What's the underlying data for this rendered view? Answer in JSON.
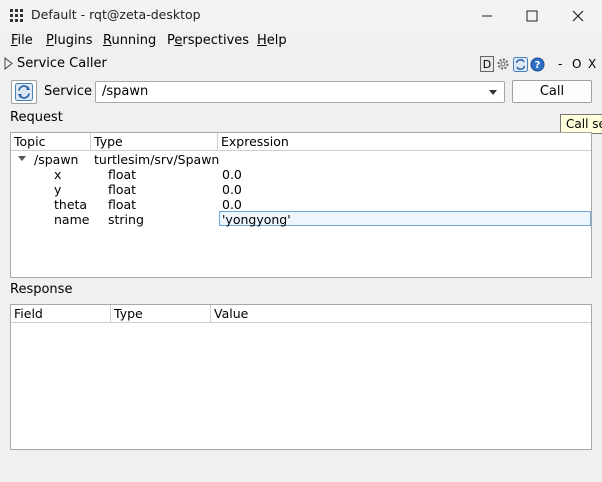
{
  "window": {
    "title": "Default - rqt@zeta-desktop",
    "minimize_icon": "minimize-icon",
    "maximize_icon": "maximize-icon",
    "close_icon": "close-icon"
  },
  "menu": {
    "file": {
      "accel": "F",
      "rest": "ile"
    },
    "plugins": {
      "accel": "P",
      "rest": "lugins"
    },
    "running": {
      "accel": "R",
      "rest": "unning"
    },
    "perspectives": {
      "pre": "P",
      "accel": "e",
      "rest": "rspectives"
    },
    "help": {
      "accel": "H",
      "rest": "elp"
    }
  },
  "dock": {
    "title": "Service Caller",
    "d_label": "D",
    "minimize_label": "-",
    "float_label": "O",
    "close_label": "X"
  },
  "service": {
    "label": "Service",
    "selected": "/spawn",
    "call_label": "Call",
    "tooltip": "Call service"
  },
  "request": {
    "label": "Request",
    "columns": [
      "Topic",
      "Type",
      "Expression"
    ],
    "root": {
      "topic": "/spawn",
      "type": "turtlesim/srv/Spawn",
      "expression": ""
    },
    "rows": [
      {
        "topic": "x",
        "type": "float",
        "expression": "0.0"
      },
      {
        "topic": "y",
        "type": "float",
        "expression": "0.0"
      },
      {
        "topic": "theta",
        "type": "float",
        "expression": "0.0"
      },
      {
        "topic": "name",
        "type": "string",
        "expression": "'yongyong'"
      }
    ]
  },
  "response": {
    "label": "Response",
    "columns": [
      "Field",
      "Type",
      "Value"
    ]
  }
}
